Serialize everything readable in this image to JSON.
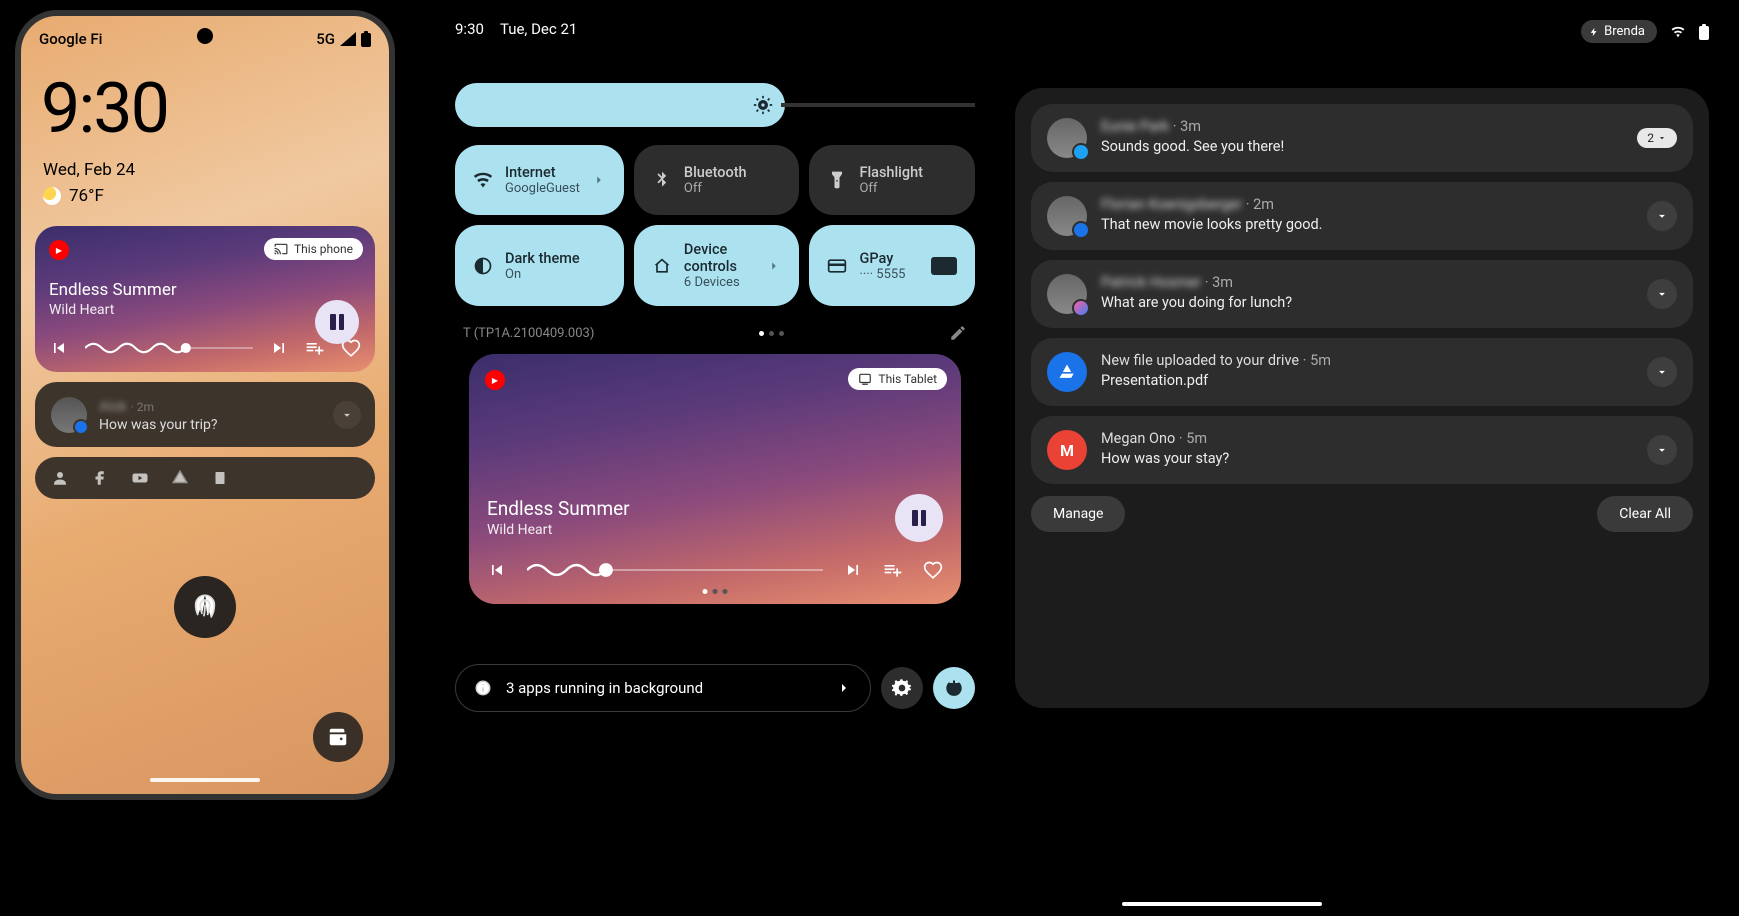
{
  "phone": {
    "carrier": "Google Fi",
    "network": "5G",
    "clock": "9:30",
    "date": "Wed, Feb 24",
    "temperature": "76°F",
    "media": {
      "cast_label": "This phone",
      "title": "Endless Summer",
      "artist": "Wild Heart"
    },
    "notification": {
      "sender": "Alok",
      "time": "2m",
      "body": "How was your trip?"
    }
  },
  "tablet": {
    "status": {
      "time": "9:30",
      "date": "Tue, Dec 21",
      "user": "Brenda"
    },
    "tiles": [
      {
        "title": "Internet",
        "sub": "GoogleGuest",
        "on": true,
        "chevron": true
      },
      {
        "title": "Bluetooth",
        "sub": "Off",
        "on": false
      },
      {
        "title": "Flashlight",
        "sub": "Off",
        "on": false
      },
      {
        "title": "Dark theme",
        "sub": "On",
        "on": true
      },
      {
        "title": "Device controls",
        "sub": "6 Devices",
        "on": true,
        "chevron": true
      },
      {
        "title": "GPay",
        "sub": "···· 5555",
        "on": true,
        "card": true
      }
    ],
    "build": "T (TP1A.2100409.003)",
    "media": {
      "cast_label": "This Tablet",
      "title": "Endless Summer",
      "artist": "Wild Heart"
    },
    "background_apps": "3 apps running in background",
    "notifications": [
      {
        "sender": "Eunie Park",
        "time": "3m",
        "body": "Sounds good. See you there!",
        "app": "twitter",
        "count": "2",
        "blur": true
      },
      {
        "sender": "Florian Koenigsberger",
        "time": "2m",
        "body": "That new movie looks pretty good.",
        "app": "messages",
        "blur": true
      },
      {
        "sender": "Patrick Hosmer",
        "time": "3m",
        "body": "What are you doing for lunch?",
        "app": "messenger",
        "blur": true
      },
      {
        "sender": "New file uploaded to your drive",
        "time": "5m",
        "body": "Presentation.pdf",
        "app": "drive",
        "blur": false
      },
      {
        "sender": "Megan Ono",
        "time": "5m",
        "body": "How was your stay?",
        "app": "gmail",
        "blur": false
      }
    ],
    "manage": "Manage",
    "clear_all": "Clear All"
  }
}
